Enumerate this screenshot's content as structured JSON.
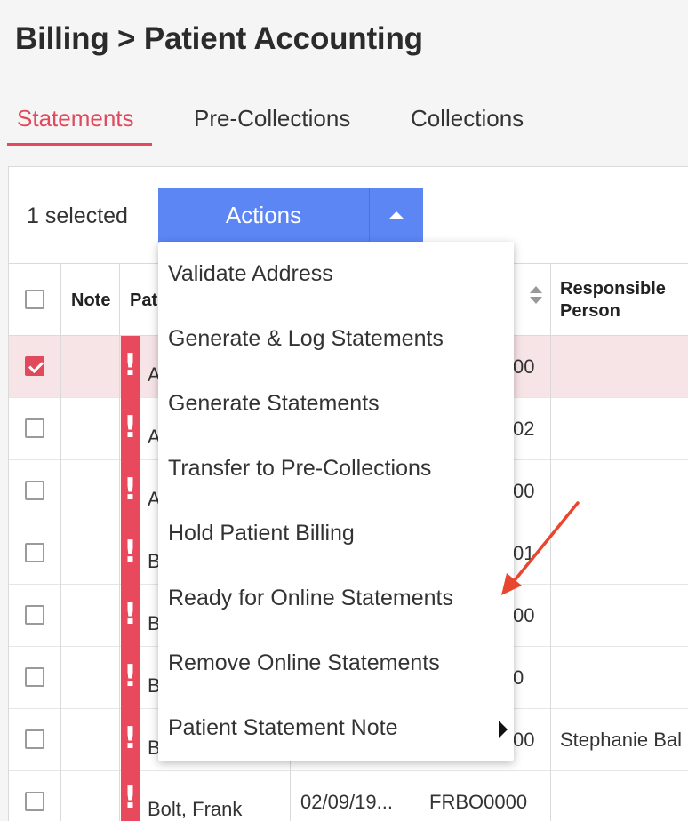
{
  "page": {
    "title": "Billing > Patient Accounting"
  },
  "tabs": [
    {
      "label": "Statements",
      "active": true
    },
    {
      "label": "Pre-Collections",
      "active": false
    },
    {
      "label": "Collections",
      "active": false
    }
  ],
  "toolbar": {
    "selected_count": "1 selected",
    "actions_label": "Actions"
  },
  "table": {
    "headers": {
      "note": "Note",
      "patient": "Pat",
      "responsible_line1": "Responsible",
      "responsible_line2": "Person"
    },
    "rows": [
      {
        "checked": true,
        "patient": "A",
        "account": "00",
        "responsible": ""
      },
      {
        "checked": false,
        "patient": "A",
        "account": "02",
        "responsible": ""
      },
      {
        "checked": false,
        "patient": "A",
        "account": "00",
        "responsible": ""
      },
      {
        "checked": false,
        "patient": "B",
        "account": "01",
        "responsible": ""
      },
      {
        "checked": false,
        "patient": "B",
        "account": "00",
        "responsible": ""
      },
      {
        "checked": false,
        "patient": "B",
        "account": "0",
        "responsible": ""
      },
      {
        "checked": false,
        "patient": "B",
        "account": "00",
        "responsible": "Stephanie Bal"
      },
      {
        "checked": false,
        "patient": "Bolt, Frank",
        "dob": "02/09/19...",
        "account": "FRBO0000",
        "responsible": ""
      }
    ]
  },
  "actions_menu": {
    "items": [
      {
        "label": "Validate Address"
      },
      {
        "label": "Generate & Log Statements"
      },
      {
        "label": "Generate Statements"
      },
      {
        "label": "Transfer to Pre-Collections"
      },
      {
        "label": "Hold Patient Billing"
      },
      {
        "label": "Ready for Online Statements"
      },
      {
        "label": "Remove Online Statements"
      },
      {
        "label": "Patient Statement Note",
        "has_submenu": true
      }
    ]
  },
  "colors": {
    "accent": "#e04a5c",
    "button": "#5b86f4",
    "alert": "#e8495c",
    "annotation_arrow": "#e8462e"
  }
}
